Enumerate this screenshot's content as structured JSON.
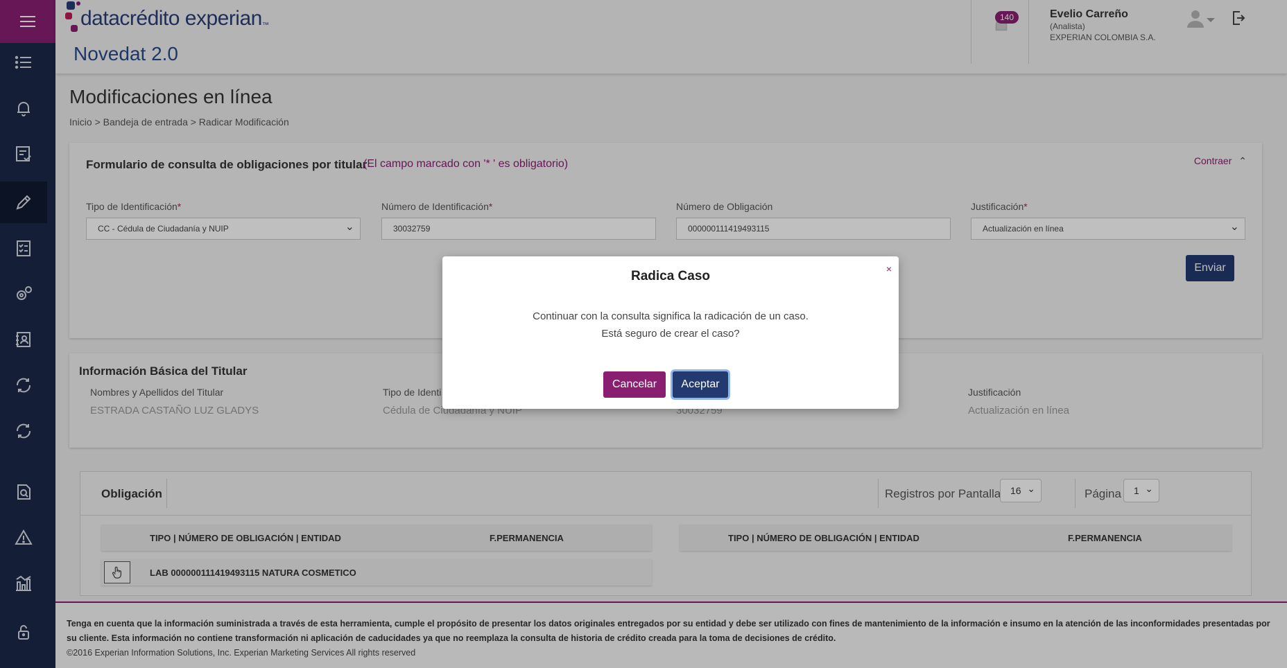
{
  "brand": {
    "logo_text": "datacrédito experian",
    "logo_mark": "™",
    "app_title": "Novedat 2.0",
    "accent": "#8a1f72",
    "navy": "#1b2949"
  },
  "sidebar": {
    "items": [
      {
        "icon": "menu-icon"
      },
      {
        "icon": "list-icon"
      },
      {
        "icon": "bell-icon"
      },
      {
        "icon": "document-check-icon"
      },
      {
        "icon": "pencil-icon"
      },
      {
        "icon": "checklist-icon"
      },
      {
        "icon": "gears-icon"
      },
      {
        "icon": "contacts-icon"
      },
      {
        "icon": "sync-icon"
      },
      {
        "icon": "sync-icon"
      },
      {
        "icon": "file-search-icon"
      },
      {
        "icon": "warning-icon"
      },
      {
        "icon": "bar-chart-icon"
      },
      {
        "icon": "lock-icon"
      }
    ]
  },
  "header": {
    "notification_count": "140",
    "user_name": "Evelio Carreño",
    "user_role": "(Analista)",
    "user_company": "EXPERIAN COLOMBIA S.A."
  },
  "page": {
    "title": "Modificaciones en línea",
    "breadcrumb": "Inicio > Bandeja de entrada > Radicar Modificación"
  },
  "form": {
    "title": "Formulario de consulta de obligaciones por titular",
    "note": "(El campo marcado con '* ' es obligatorio)",
    "collapse_label": "Contraer",
    "fields": [
      {
        "label": "Tipo de Identificación",
        "required": "*",
        "value": "CC - Cédula de Ciudadanía y NUIP",
        "type": "select"
      },
      {
        "label": "Número de Identificación",
        "required": "*",
        "value": "30032759",
        "type": "input"
      },
      {
        "label": "Número de Obligación",
        "required": "",
        "value": "000000111419493115",
        "type": "input"
      },
      {
        "label": "Justificación",
        "required": "*",
        "value": "Actualización en línea",
        "type": "select"
      }
    ],
    "submit_label": "Enviar"
  },
  "info": {
    "title": "Información Básica del Titular",
    "columns": [
      {
        "label": "Nombres y Apellidos del Titular",
        "value": "ESTRADA CASTAÑO LUZ GLADYS"
      },
      {
        "label": "Tipo de Identi",
        "value": "Cédula de Ciudadanía y NUIP"
      },
      {
        "label": "",
        "value": "30032759"
      },
      {
        "label": "Justificación",
        "value": "Actualización en línea"
      }
    ]
  },
  "obligations": {
    "title": "Obligación",
    "per_page_label": "Registros por Pantalla",
    "per_page_value": "16",
    "page_label": "Página",
    "page_value": "1",
    "col_type": "TIPO | NÚMERO DE OBLIGACIÓN | ENTIDAD",
    "col_perm": "F.PERMANENCIA",
    "rows": [
      {
        "text": "LAB 000000111419493115 NATURA COSMETICO"
      }
    ]
  },
  "footer": {
    "notice": "Tenga en cuenta que la información suministrada a través de esta herramienta, cumple el propósito de presentar los datos originales entregados por su entidad y debe ser utilizado con fines de mantenimiento de la información e insumo en la atención de las inconformidades presentadas por su cliente. Esta información no contiene transformación ni aplicación de caducidades ya que no reemplaza la consulta de historia de crédito creada para la toma de decisiones de crédito.",
    "copyright": "©2016 Experian Information Solutions, Inc. Experian Marketing Services All rights reserved"
  },
  "modal": {
    "title": "Radica Caso",
    "close": "×",
    "line1": "Continuar con la consulta significa la radicación de un caso.",
    "line2": "Está seguro de crear el caso?",
    "cancel_label": "Cancelar",
    "ok_label": "Aceptar"
  }
}
